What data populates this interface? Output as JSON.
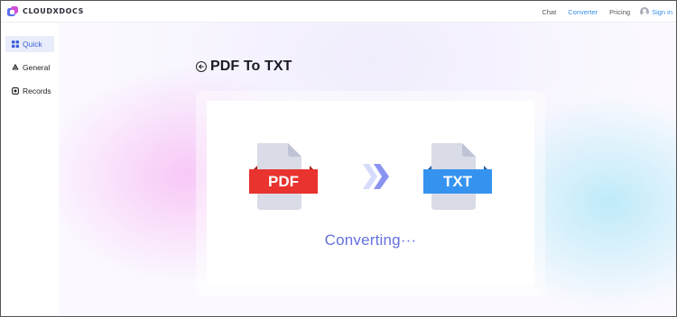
{
  "brand": {
    "name": "CLOUDXDOCS"
  },
  "nav": {
    "items": [
      {
        "label": "Chat",
        "active": false
      },
      {
        "label": "Converter",
        "active": true
      },
      {
        "label": "Pricing",
        "active": false
      }
    ],
    "signin_label": "Sign in"
  },
  "sidebar": {
    "items": [
      {
        "label": "Quick",
        "icon": "grid-icon",
        "active": true
      },
      {
        "label": "General",
        "icon": "recycle-icon",
        "active": false
      },
      {
        "label": "Records",
        "icon": "record-icon",
        "active": false
      }
    ]
  },
  "page": {
    "title": "PDF To TXT",
    "source_format": "PDF",
    "target_format": "TXT",
    "status": "Converting···"
  },
  "colors": {
    "accent": "#3a8fe8",
    "pdf_band": "#e8332e",
    "txt_band": "#3593ef",
    "status_text": "#6471de",
    "arrow": "#8a93f0"
  }
}
